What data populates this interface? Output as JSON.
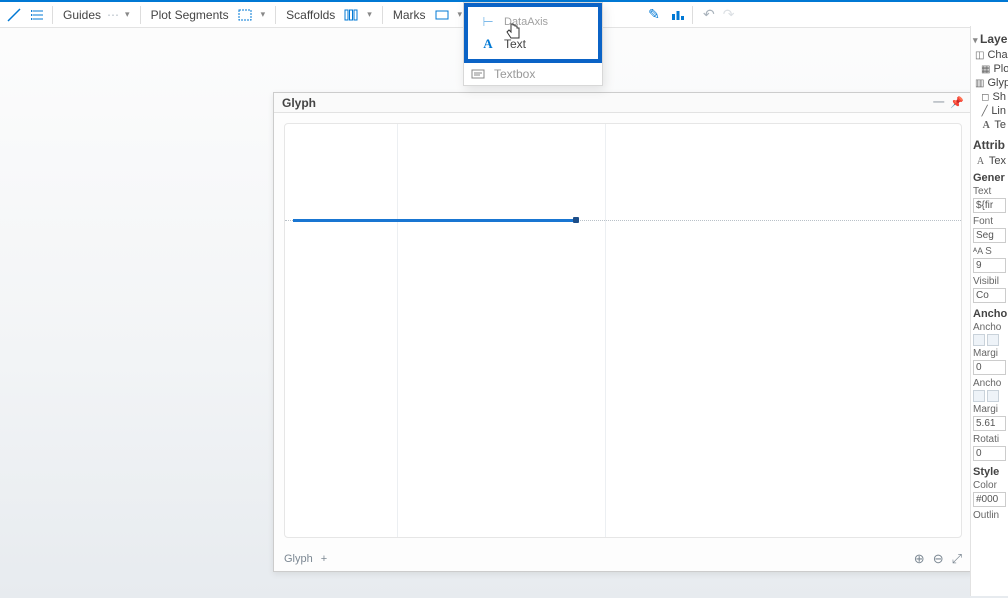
{
  "toolbar": {
    "guides": "Guides",
    "plotSegments": "Plot Segments",
    "scaffolds": "Scaffolds",
    "marks": "Marks"
  },
  "flyout": {
    "dataAxis": "DataAxis",
    "text": "Text",
    "textbox": "Textbox"
  },
  "glyph": {
    "title": "Glyph",
    "footerLabel": "Glyph"
  },
  "layers": {
    "title": "Layers",
    "chart": "Chart",
    "plot": "Plo",
    "glyph": "Glyph",
    "shape": "Sh",
    "line": "Lin",
    "text": "Te"
  },
  "attrs": {
    "title": "Attrib",
    "textItem": "Tex",
    "general": "Gener",
    "textLbl": "Text",
    "textVal": "${fir",
    "fontLbl": "Font",
    "fontVal": "Seg",
    "sizeLbl": "S",
    "sizeVal": "9",
    "visibilityLbl": "Visibil",
    "visibilityVal": "Co",
    "anchorSec": "Ancho",
    "anchorLbl": "Ancho",
    "marginLbl": "Margi",
    "marginVal1": "0",
    "marginVal2": "5.61",
    "rotationLbl": "Rotati",
    "rotationVal": "0",
    "styleSec": "Style",
    "colorLbl": "Color",
    "colorVal": "#000",
    "outlineLbl": "Outlin"
  }
}
